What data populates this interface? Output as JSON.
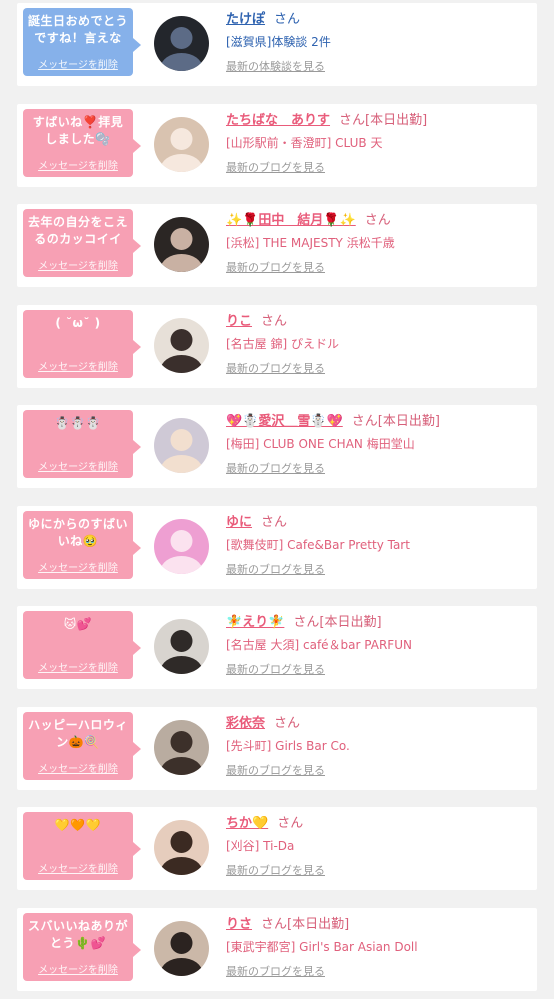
{
  "items": [
    {
      "theme": "blue",
      "msg": "誕生日おめでとうですね！言えな",
      "delete": "メッセージを削除",
      "name": "たけぽ",
      "san": "さん",
      "work": "",
      "shop": "[滋賀県]体験談 2件",
      "link": "最新の体験談を見る",
      "avatar": {
        "bg": "#23262c",
        "fg": "#5c6b86"
      }
    },
    {
      "theme": "pink",
      "msg": "すばいね❣️拝見しました🫧",
      "delete": "メッセージを削除",
      "name": "たちばな　ありす",
      "san": "さん",
      "work": "[本日出勤]",
      "shop": "[山形駅前・香澄町] CLUB 天",
      "link": "最新のブログを見る",
      "avatar": {
        "bg": "#d9c3b0",
        "fg": "#f6e8de"
      }
    },
    {
      "theme": "pink",
      "msg": "去年の自分をこえるのカッコイイ",
      "delete": "メッセージを削除",
      "name": "✨🌹田中　結月🌹✨",
      "san": "さん",
      "work": "",
      "shop": "[浜松] THE MAJESTY 浜松千歳",
      "link": "最新のブログを見る",
      "avatar": {
        "bg": "#2b2624",
        "fg": "#c9b1a3"
      }
    },
    {
      "theme": "pink",
      "msg": "( ˘ω˘ )",
      "delete": "メッセージを削除",
      "name": "りこ",
      "san": "さん",
      "work": "",
      "shop": "[名古屋 錦] ぴえドル",
      "link": "最新のブログを見る",
      "avatar": {
        "bg": "#e7e0d8",
        "fg": "#3a2f2c"
      }
    },
    {
      "theme": "pink",
      "msg": "☃️☃️☃️",
      "delete": "メッセージを削除",
      "name": "💖☃️愛沢＿雪☃️💖",
      "san": "さん",
      "work": "[本日出勤]",
      "shop": "[梅田] CLUB ONE CHAN 梅田堂山",
      "link": "最新のブログを見る",
      "avatar": {
        "bg": "#cfc9d6",
        "fg": "#f2dfcf"
      }
    },
    {
      "theme": "pink",
      "msg": "ゆにからのすばいいね🥹",
      "delete": "メッセージを削除",
      "name": "ゆに",
      "san": "さん",
      "work": "",
      "shop": "[歌舞伎町] Cafe&Bar Pretty Tart",
      "link": "最新のブログを見る",
      "avatar": {
        "bg": "#ee9fd2",
        "fg": "#fbe2ef"
      }
    },
    {
      "theme": "pink",
      "msg": "🐱💕",
      "delete": "メッセージを削除",
      "name": "🧚えり🧚",
      "san": "さん",
      "work": "[本日出勤]",
      "shop": "[名古屋 大須] café＆bar PARFUN",
      "link": "最新のブログを見る",
      "avatar": {
        "bg": "#d8d4cf",
        "fg": "#2f2a28"
      }
    },
    {
      "theme": "pink",
      "msg": "ハッピーハロウィン🎃🍭",
      "delete": "メッセージを削除",
      "name": "彩依奈",
      "san": "さん",
      "work": "",
      "shop": "[先斗町] Girls Bar Co.",
      "link": "最新のブログを見る",
      "avatar": {
        "bg": "#b9aca0",
        "fg": "#3c302a"
      }
    },
    {
      "theme": "pink",
      "msg": "💛🧡💛",
      "delete": "メッセージを削除",
      "name": "ちか💛",
      "san": "さん",
      "work": "",
      "shop": "[刈谷] Ti-Da",
      "link": "最新のブログを見る",
      "avatar": {
        "bg": "#e6cdbd",
        "fg": "#3b2a22"
      }
    },
    {
      "theme": "pink",
      "msg": "スバいいねありがとう🌵💕",
      "delete": "メッセージを削除",
      "name": "りさ",
      "san": "さん",
      "work": "[本日出勤]",
      "shop": "[東武宇都宮] Girl's Bar Asian Doll",
      "link": "最新のブログを見る",
      "avatar": {
        "bg": "#cbb8a8",
        "fg": "#2b2320"
      }
    }
  ]
}
